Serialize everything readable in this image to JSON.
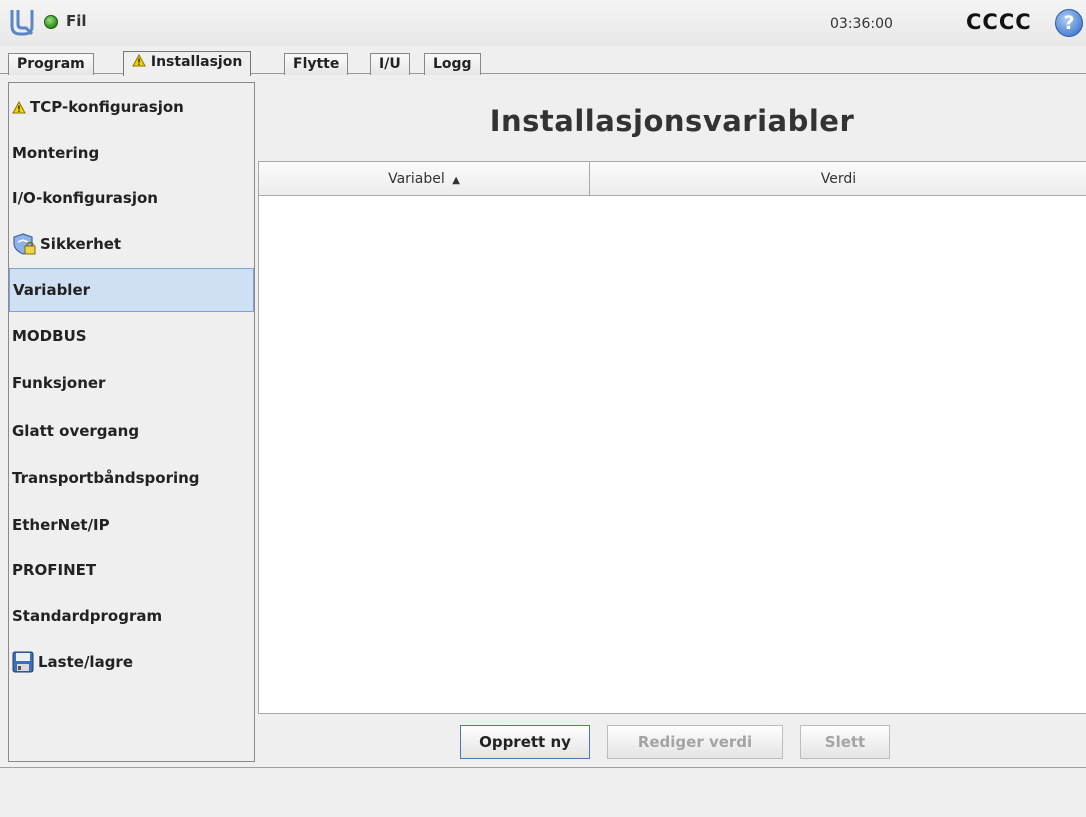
{
  "header": {
    "file_menu": "Fil",
    "time": "03:36:00",
    "robot_name": "CCCC",
    "help_symbol": "?",
    "status_color": "#2d8a1c"
  },
  "tabs": [
    {
      "label": "Program",
      "active": false
    },
    {
      "label": "Installasjon",
      "active": true,
      "warning": true
    },
    {
      "label": "Flytte",
      "active": false
    },
    {
      "label": "I/U",
      "active": false
    },
    {
      "label": "Logg",
      "active": false
    }
  ],
  "sidebar": {
    "items": [
      {
        "label": "TCP-konfigurasjon",
        "icon": "warning-icon"
      },
      {
        "label": "Montering"
      },
      {
        "label": "I/O-konfigurasjon"
      },
      {
        "label": "Sikkerhet",
        "icon": "shield-lock-icon"
      },
      {
        "label": "Variabler",
        "selected": true
      },
      {
        "label": "MODBUS"
      },
      {
        "label": "Funksjoner"
      },
      {
        "label": "Glatt overgang"
      },
      {
        "label": "Transportbåndsporing"
      },
      {
        "label": "EtherNet/IP"
      },
      {
        "label": "PROFINET"
      },
      {
        "label": "Standardprogram"
      },
      {
        "label": "Laste/lagre",
        "icon": "floppy-disk-icon"
      }
    ]
  },
  "main": {
    "title": "Installasjonsvariabler",
    "table": {
      "columns": [
        "Variabel",
        "Verdi"
      ],
      "sort_indicator": "▲",
      "rows": []
    },
    "buttons": {
      "create_new": "Opprett ny",
      "edit_value": "Rediger verdi",
      "delete": "Slett"
    }
  },
  "colors": {
    "selection": "#cfe0f4",
    "accent": "#4a7fd0",
    "warning": "#e6c300"
  }
}
